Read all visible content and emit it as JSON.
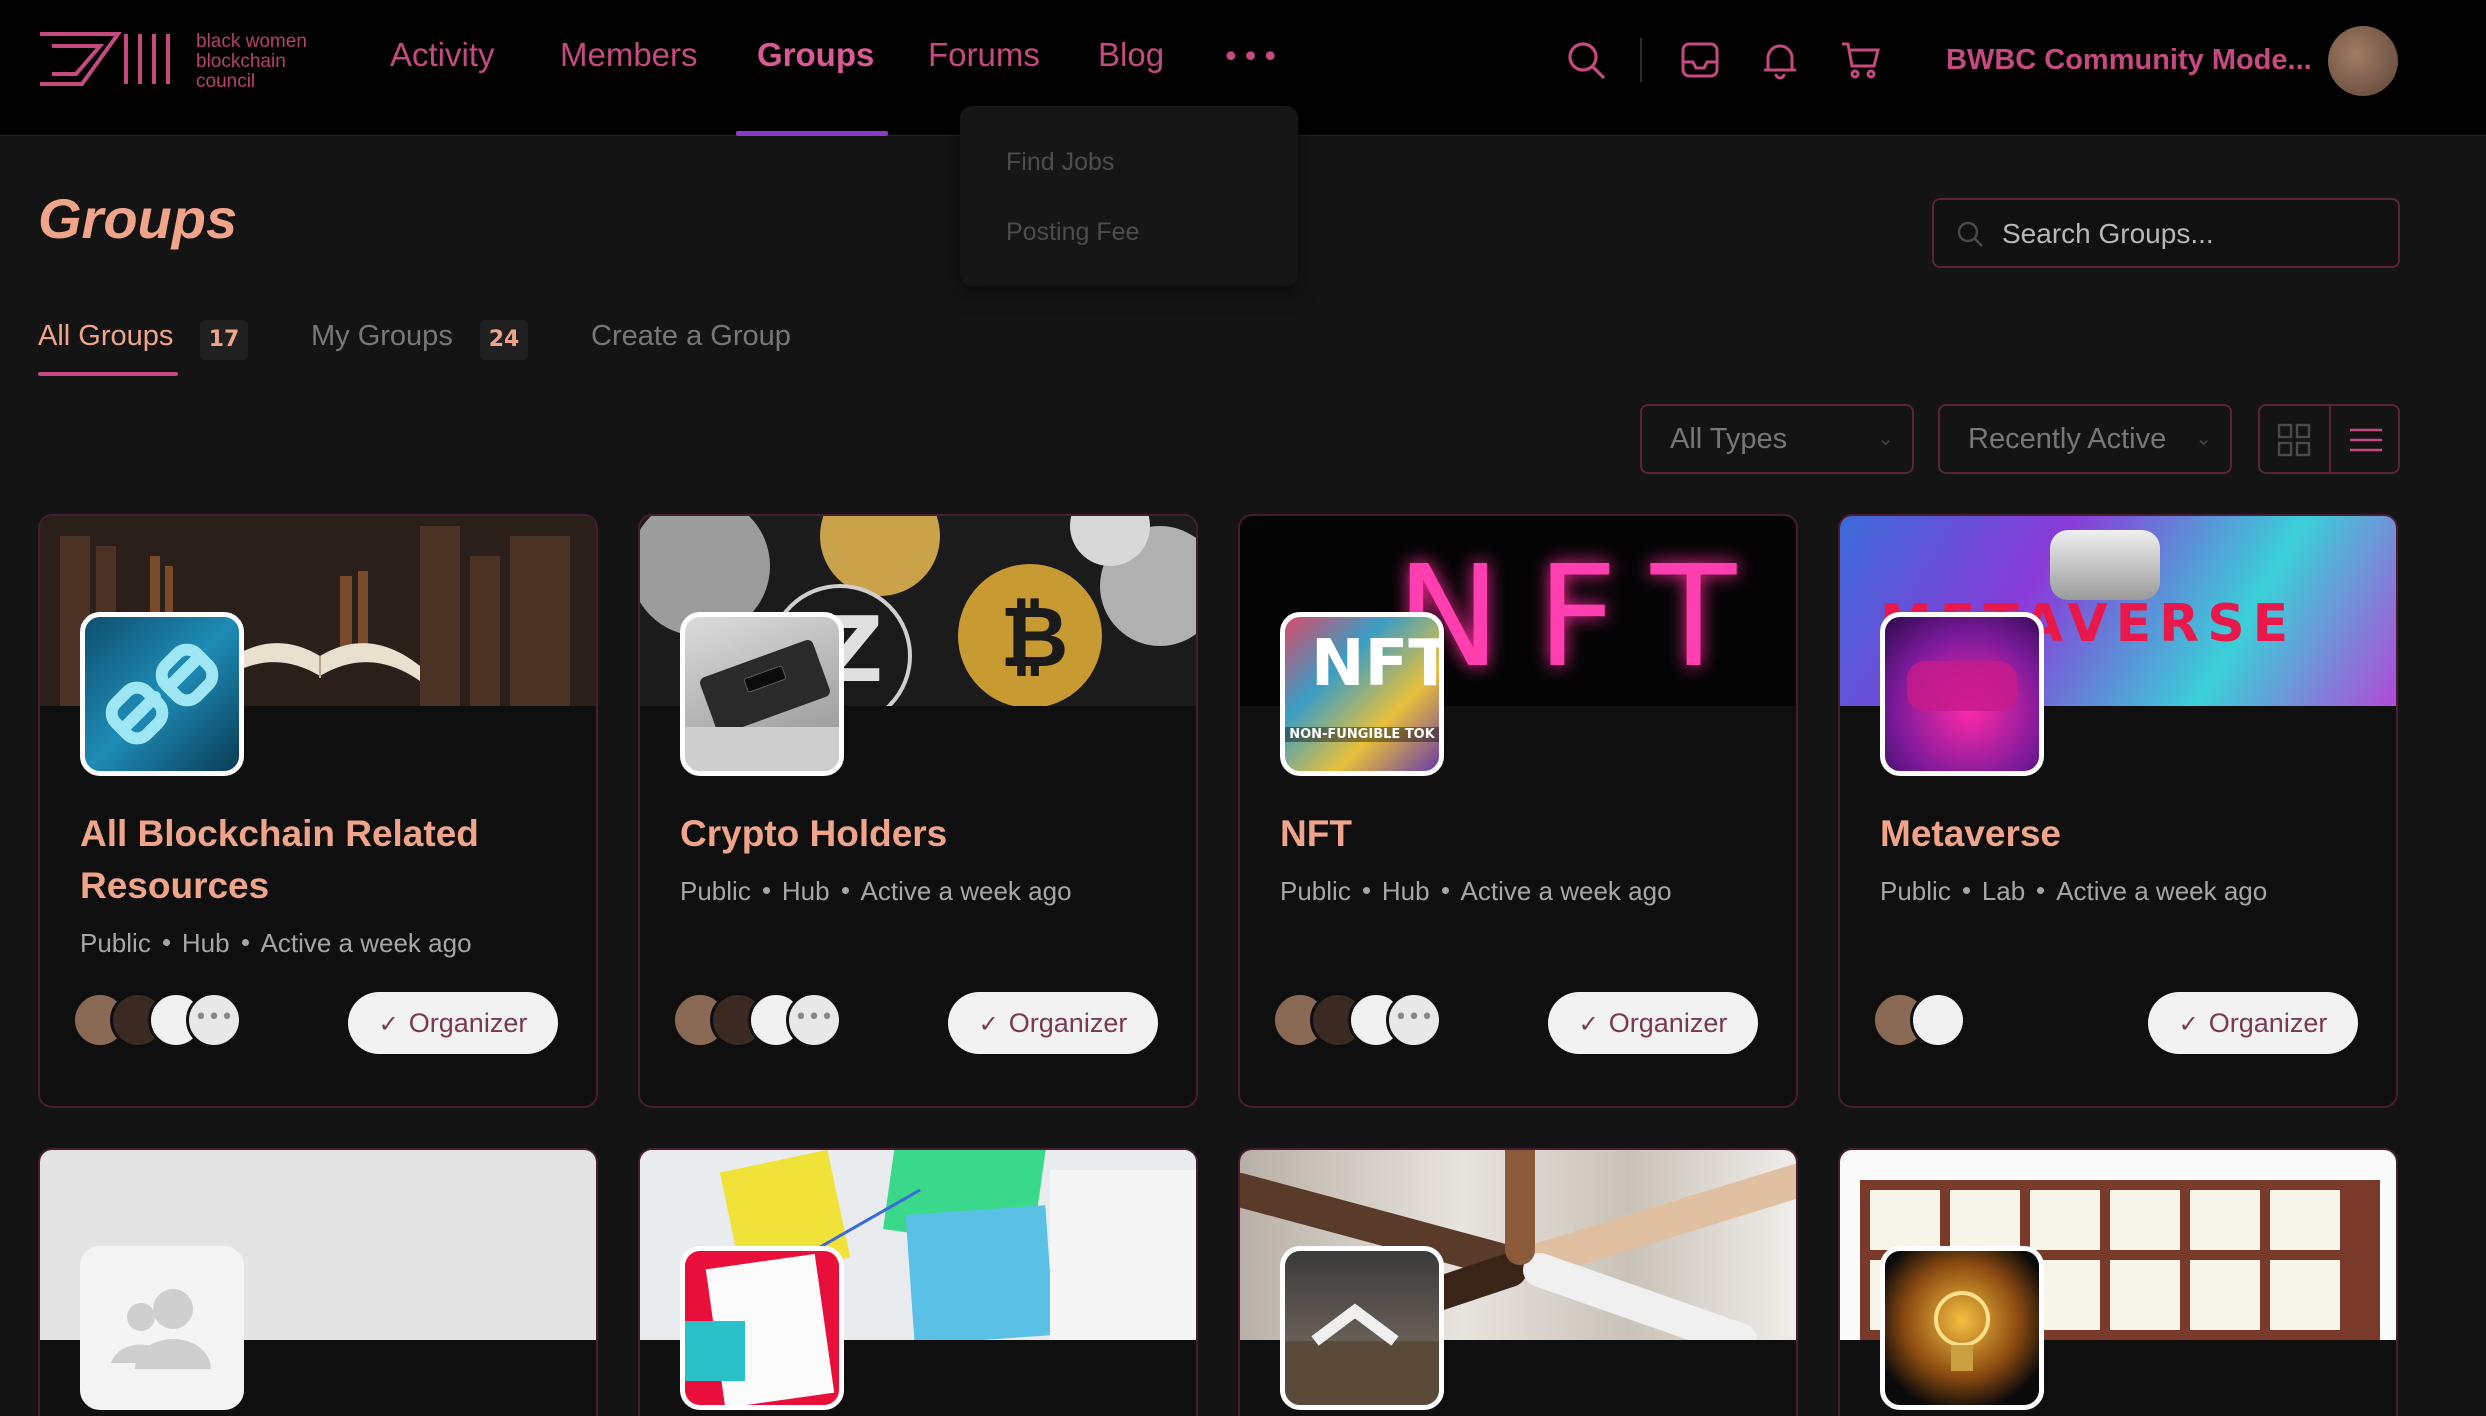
{
  "logo": {
    "line1": "black women",
    "line2": "blockchain",
    "line3": "council"
  },
  "nav": {
    "items": [
      "Activity",
      "Members",
      "Groups",
      "Forums",
      "Blog"
    ],
    "active": "Groups",
    "more_label": "•••",
    "dropdown": [
      "Find Jobs",
      "Posting Fee"
    ],
    "user_name": "BWBC Community Mode..."
  },
  "page": {
    "title": "Groups",
    "search_placeholder": "Search Groups..."
  },
  "tabs": {
    "all_label": "All Groups",
    "all_count": "17",
    "my_label": "My Groups",
    "my_count": "24",
    "create_label": "Create a Group"
  },
  "filters": {
    "type": "All Types",
    "sort": "Recently Active"
  },
  "cards": [
    {
      "title": "All Blockchain Related Resources",
      "privacy": "Public",
      "type": "Hub",
      "activity": "Active a week ago",
      "button": "Organizer"
    },
    {
      "title": "Crypto Holders",
      "privacy": "Public",
      "type": "Hub",
      "activity": "Active a week ago",
      "button": "Organizer"
    },
    {
      "title": "NFT",
      "privacy": "Public",
      "type": "Hub",
      "activity": "Active a week ago",
      "button": "Organizer"
    },
    {
      "title": "Metaverse",
      "privacy": "Public",
      "type": "Lab",
      "activity": "Active a week ago",
      "button": "Organizer"
    }
  ],
  "cover_text": {
    "nft": "NFT",
    "nft_thumb": "NFT",
    "nft_thumb_sub": "NON-FUNGIBLE TOK",
    "metaverse": "METAVERSE"
  },
  "colors": {
    "accent": "#c44a80",
    "title": "#f0a58a",
    "border": "#4a1c2f",
    "nav_underline": "#8a3ac8"
  }
}
